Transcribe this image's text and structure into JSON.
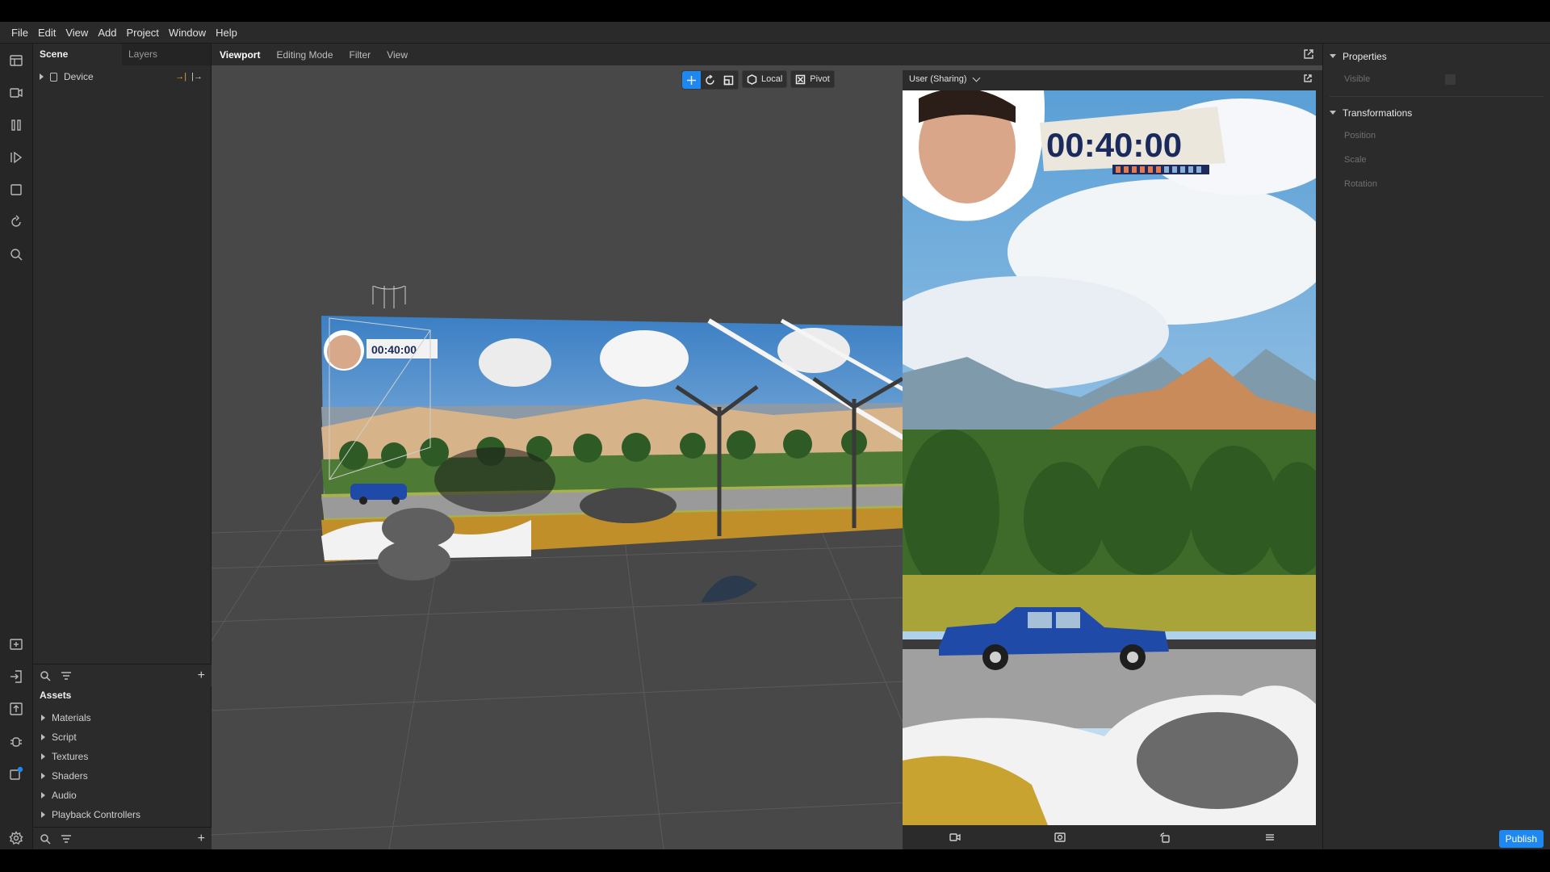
{
  "menu": [
    "File",
    "Edit",
    "View",
    "Add",
    "Project",
    "Window",
    "Help"
  ],
  "scene_panel": {
    "tabs": [
      "Scene",
      "Layers"
    ],
    "tree": [
      {
        "label": "Device"
      }
    ]
  },
  "assets": {
    "title": "Assets",
    "items": [
      "Materials",
      "Script",
      "Textures",
      "Shaders",
      "Audio",
      "Playback Controllers"
    ]
  },
  "viewport": {
    "tabs": [
      "Viewport",
      "Editing Mode",
      "Filter",
      "View"
    ],
    "tools": {
      "local_label": "Local",
      "pivot_label": "Pivot"
    },
    "board_timer": "00:40:00"
  },
  "preview": {
    "user_label": "User (Sharing)",
    "timer": "00:40:00"
  },
  "properties": {
    "title": "Properties",
    "visible_label": "Visible",
    "transformations_title": "Transformations",
    "fields": [
      "Position",
      "Scale",
      "Rotation"
    ]
  },
  "publish_label": "Publish",
  "colors": {
    "accent": "#1f87f0",
    "highlight": "#e8a23b"
  },
  "icons": [
    "layout-icon",
    "camera-icon",
    "columns-icon",
    "play-icon",
    "square-icon",
    "refresh-icon",
    "search-icon",
    "folder-add-icon",
    "import-icon",
    "export-icon",
    "bug-icon",
    "notification-icon",
    "settings-icon"
  ]
}
